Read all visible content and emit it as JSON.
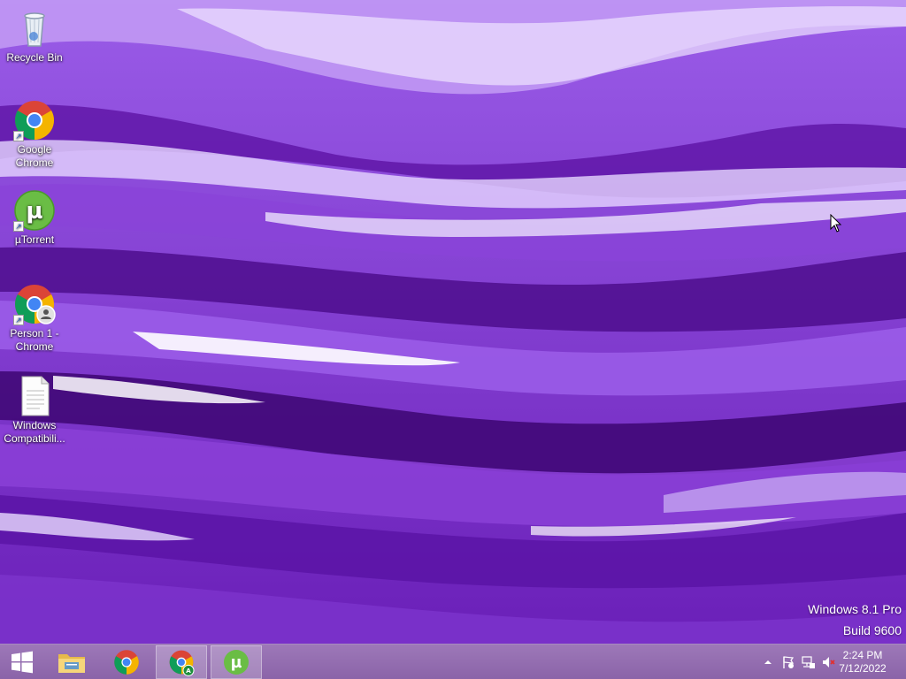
{
  "desktop": {
    "icons": [
      {
        "label": "Recycle Bin",
        "icon": "recycle-bin-icon"
      },
      {
        "label": "Google Chrome",
        "icon": "chrome-icon"
      },
      {
        "label": "µTorrent",
        "icon": "utorrent-icon"
      },
      {
        "label": "Person 1 - Chrome",
        "icon": "chrome-profile-icon"
      },
      {
        "label": "Windows Compatibili...",
        "icon": "document-icon"
      }
    ],
    "watermark": {
      "edition": "Windows 8.1 Pro",
      "build": "Build 9600"
    }
  },
  "taskbar": {
    "buttons": [
      {
        "name": "start",
        "icon": "windows-logo-icon"
      },
      {
        "name": "file-explorer",
        "icon": "folder-icon"
      },
      {
        "name": "chrome",
        "icon": "chrome-icon"
      },
      {
        "name": "chrome-profile",
        "icon": "chrome-profile-icon",
        "active": true
      },
      {
        "name": "utorrent",
        "icon": "utorrent-icon",
        "active": true
      }
    ],
    "tray": {
      "icons": [
        "show-hidden-icons-chevron-icon",
        "action-center-flag-icon",
        "network-icon",
        "volume-muted-icon"
      ],
      "time": "2:24 PM",
      "date": "7/12/2022"
    }
  },
  "colors": {
    "wallpaper_base": "#7b2fd0",
    "wallpaper_light": "#e9dcff",
    "wallpaper_dark": "#3b0763",
    "taskbar": "#9470b0"
  }
}
